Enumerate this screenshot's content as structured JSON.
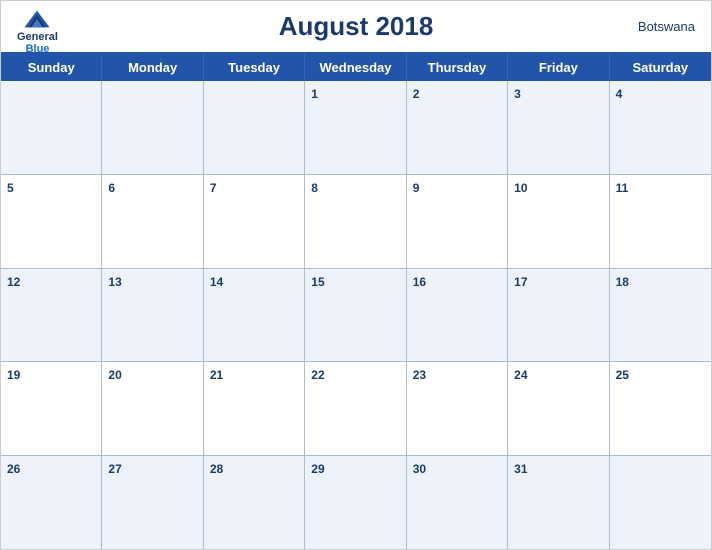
{
  "header": {
    "title": "August 2018",
    "region": "Botswana",
    "logo_general": "General",
    "logo_blue": "Blue"
  },
  "days_of_week": [
    "Sunday",
    "Monday",
    "Tuesday",
    "Wednesday",
    "Thursday",
    "Friday",
    "Saturday"
  ],
  "weeks": [
    [
      {
        "date": "",
        "empty": true
      },
      {
        "date": "",
        "empty": true
      },
      {
        "date": "",
        "empty": true
      },
      {
        "date": "1",
        "empty": false
      },
      {
        "date": "2",
        "empty": false
      },
      {
        "date": "3",
        "empty": false
      },
      {
        "date": "4",
        "empty": false
      }
    ],
    [
      {
        "date": "5",
        "empty": false
      },
      {
        "date": "6",
        "empty": false
      },
      {
        "date": "7",
        "empty": false
      },
      {
        "date": "8",
        "empty": false
      },
      {
        "date": "9",
        "empty": false
      },
      {
        "date": "10",
        "empty": false
      },
      {
        "date": "11",
        "empty": false
      }
    ],
    [
      {
        "date": "12",
        "empty": false
      },
      {
        "date": "13",
        "empty": false
      },
      {
        "date": "14",
        "empty": false
      },
      {
        "date": "15",
        "empty": false
      },
      {
        "date": "16",
        "empty": false
      },
      {
        "date": "17",
        "empty": false
      },
      {
        "date": "18",
        "empty": false
      }
    ],
    [
      {
        "date": "19",
        "empty": false
      },
      {
        "date": "20",
        "empty": false
      },
      {
        "date": "21",
        "empty": false
      },
      {
        "date": "22",
        "empty": false
      },
      {
        "date": "23",
        "empty": false
      },
      {
        "date": "24",
        "empty": false
      },
      {
        "date": "25",
        "empty": false
      }
    ],
    [
      {
        "date": "26",
        "empty": false
      },
      {
        "date": "27",
        "empty": false
      },
      {
        "date": "28",
        "empty": false
      },
      {
        "date": "29",
        "empty": false
      },
      {
        "date": "30",
        "empty": false
      },
      {
        "date": "31",
        "empty": false
      },
      {
        "date": "",
        "empty": true
      }
    ]
  ]
}
